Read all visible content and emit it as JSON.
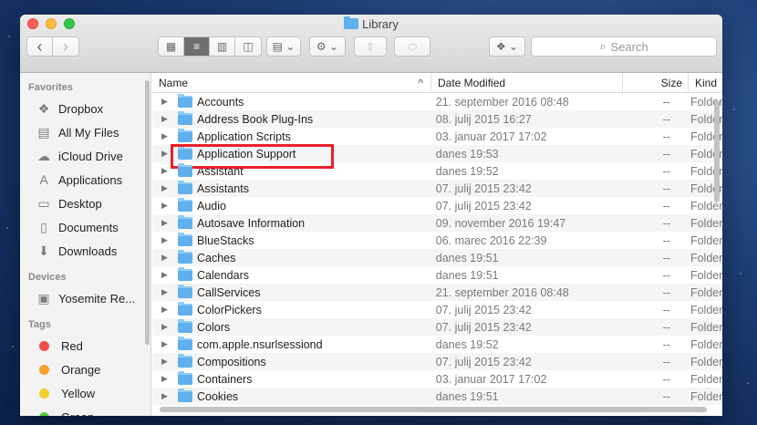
{
  "window": {
    "title": "Library",
    "search_placeholder": "Search"
  },
  "toolbar": {
    "back": "‹",
    "forward": "›",
    "view_icon": "▦",
    "view_list": "≡",
    "view_columns": "▥",
    "view_cover": "◫",
    "arrange": "▤ ⌄",
    "action": "⚙ ⌄",
    "share": "⇧",
    "tags": "⬭",
    "dropbox": "❖ ⌄"
  },
  "sidebar": {
    "favorites_header": "Favorites",
    "favorites": [
      {
        "label": "Dropbox",
        "icon": "dropbox-icon",
        "glyph": "❖"
      },
      {
        "label": "All My Files",
        "icon": "all-files-icon",
        "glyph": "▤"
      },
      {
        "label": "iCloud Drive",
        "icon": "cloud-icon",
        "glyph": "☁"
      },
      {
        "label": "Applications",
        "icon": "applications-icon",
        "glyph": "A"
      },
      {
        "label": "Desktop",
        "icon": "desktop-icon",
        "glyph": "▭"
      },
      {
        "label": "Documents",
        "icon": "documents-icon",
        "glyph": "▯"
      },
      {
        "label": "Downloads",
        "icon": "downloads-icon",
        "glyph": "⬇"
      }
    ],
    "devices_header": "Devices",
    "devices": [
      {
        "label": "Yosemite Re...",
        "icon": "disk-icon",
        "glyph": "▣"
      }
    ],
    "tags_header": "Tags",
    "tags": [
      {
        "label": "Red",
        "color": "#f2504a"
      },
      {
        "label": "Orange",
        "color": "#f8a02c"
      },
      {
        "label": "Yellow",
        "color": "#f5cf2f"
      },
      {
        "label": "Green",
        "color": "#5dc83f"
      }
    ]
  },
  "columns": {
    "name": "Name",
    "sort_indicator": "^",
    "date": "Date Modified",
    "size": "Size",
    "kind": "Kind"
  },
  "rows": [
    {
      "name": "Accounts",
      "date": "21. september 2016 08:48",
      "size": "--",
      "kind": "Folder"
    },
    {
      "name": "Address Book Plug-Ins",
      "date": "08. julij 2015 16:27",
      "size": "--",
      "kind": "Folder"
    },
    {
      "name": "Application Scripts",
      "date": "03. januar 2017 17:02",
      "size": "--",
      "kind": "Folder"
    },
    {
      "name": "Application Support",
      "date": "danes 19:53",
      "size": "--",
      "kind": "Folder"
    },
    {
      "name": "Assistant",
      "date": "danes 19:52",
      "size": "--",
      "kind": "Folder"
    },
    {
      "name": "Assistants",
      "date": "07. julij 2015 23:42",
      "size": "--",
      "kind": "Folder"
    },
    {
      "name": "Audio",
      "date": "07. julij 2015 23:42",
      "size": "--",
      "kind": "Folder"
    },
    {
      "name": "Autosave Information",
      "date": "09. november 2016 19:47",
      "size": "--",
      "kind": "Folder"
    },
    {
      "name": "BlueStacks",
      "date": "06. marec 2016 22:39",
      "size": "--",
      "kind": "Folder"
    },
    {
      "name": "Caches",
      "date": "danes 19:51",
      "size": "--",
      "kind": "Folder"
    },
    {
      "name": "Calendars",
      "date": "danes 19:51",
      "size": "--",
      "kind": "Folder"
    },
    {
      "name": "CallServices",
      "date": "21. september 2016 08:48",
      "size": "--",
      "kind": "Folder"
    },
    {
      "name": "ColorPickers",
      "date": "07. julij 2015 23:42",
      "size": "--",
      "kind": "Folder"
    },
    {
      "name": "Colors",
      "date": "07. julij 2015 23:42",
      "size": "--",
      "kind": "Folder"
    },
    {
      "name": "com.apple.nsurlsessiond",
      "date": "danes 19:52",
      "size": "--",
      "kind": "Folder"
    },
    {
      "name": "Compositions",
      "date": "07. julij 2015 23:42",
      "size": "--",
      "kind": "Folder"
    },
    {
      "name": "Containers",
      "date": "03. januar 2017 17:02",
      "size": "--",
      "kind": "Folder"
    },
    {
      "name": "Cookies",
      "date": "danes 19:51",
      "size": "--",
      "kind": "Folder"
    }
  ],
  "highlighted_row_index": 3,
  "highlight_color": "#e8202a"
}
